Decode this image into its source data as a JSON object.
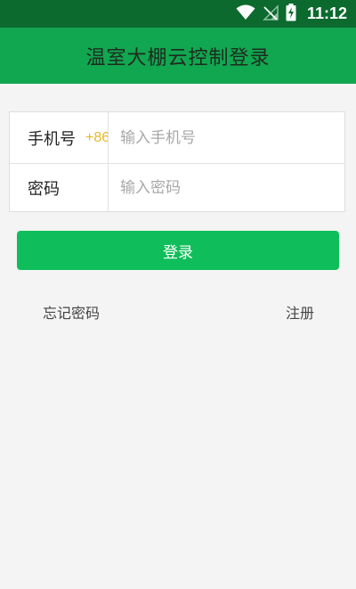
{
  "status_bar": {
    "time": "11:12",
    "icons": [
      "wifi-icon",
      "no-signal-icon",
      "battery-charging-icon"
    ]
  },
  "header": {
    "title": "温室大棚云控制登录"
  },
  "form": {
    "phone": {
      "label": "手机号",
      "country_code": "+86",
      "placeholder": "输入手机号",
      "value": ""
    },
    "password": {
      "label": "密码",
      "placeholder": "输入密码",
      "value": ""
    }
  },
  "actions": {
    "login_label": "登录",
    "forgot_password_label": "忘记密码",
    "register_label": "注册"
  },
  "colors": {
    "status_bar": "#0c6a2e",
    "header": "#11a650",
    "button": "#0fbe5a",
    "country_code": "#e8b923",
    "background": "#f4f4f4"
  }
}
